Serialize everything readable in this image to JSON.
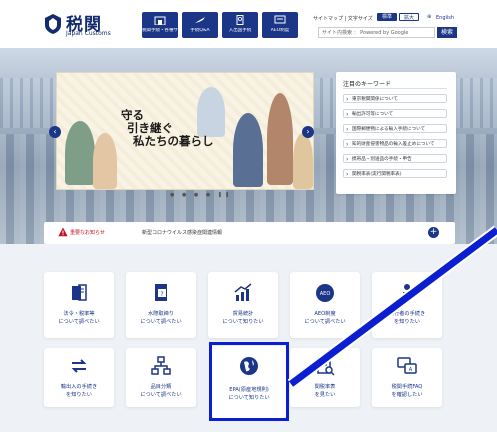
{
  "header": {
    "logo_jp": "税関",
    "logo_en": "Japan Customs",
    "nav": [
      {
        "label": "税関手続・各種サービス",
        "icon": "building-icon"
      },
      {
        "label": "手続Q&A",
        "icon": "plane-icon"
      },
      {
        "label": "入出国手続",
        "icon": "passport-icon"
      },
      {
        "label": "AEO制度",
        "icon": "certificate-icon"
      }
    ],
    "util_text": "サイトマップ | 文字サイズ",
    "size_std": "標準",
    "size_large": "拡大",
    "lang": "English",
    "search_placeholder": "サイト内検索 ： Powered by Google",
    "search_button": "検索"
  },
  "hero": {
    "slogan": [
      "守る",
      "引き継ぐ",
      "私たちの暮らし"
    ],
    "pager": "● ● ● ● ❚❚"
  },
  "keywords": {
    "title": "注目のキーワード",
    "items": [
      "東京税関関係について",
      "輸出許可等について",
      "国際郵便物による輸入手続について",
      "知的財産侵害物品の輸入差止めについて",
      "携帯品・別送品の手続・申告",
      "関税率表(実行関税率表)"
    ]
  },
  "notice": {
    "label": "重要なお知らせ",
    "text": "新型コロナウイルス感染症関連情報"
  },
  "tiles_row1": [
    {
      "label": [
        "法令・税率等",
        "について調べたい"
      ],
      "icon": "book-icon"
    },
    {
      "label": [
        "水際取締り",
        "について調べたい"
      ],
      "icon": "document-icon"
    },
    {
      "label": [
        "貿易統計",
        "について知りたい"
      ],
      "icon": "chart-icon"
    },
    {
      "label": [
        "AEO制度",
        "について調べたい"
      ],
      "icon": "aeo-icon"
    },
    {
      "label": [
        "旅行者の手続き",
        "を知りたい"
      ],
      "icon": "traveler-icon"
    }
  ],
  "tiles_row2": [
    {
      "label": [
        "輸出入の手続き",
        "を知りたい"
      ],
      "icon": "exchange-icon"
    },
    {
      "label": [
        "品目分類",
        "について調べたい"
      ],
      "icon": "hierarchy-icon"
    },
    {
      "label": [
        "EPA(原産地規則)",
        "について知りたい"
      ],
      "icon": "globe-icon"
    },
    {
      "label": [
        "関税率表",
        "を見たい"
      ],
      "icon": "tariff-table-icon"
    },
    {
      "label": [
        "税関手続FAQ",
        "を確認したい"
      ],
      "icon": "faq-icon"
    }
  ],
  "colors": {
    "brand": "#1b3587",
    "highlight": "#0b1fd0",
    "warning": "#c1121f"
  }
}
